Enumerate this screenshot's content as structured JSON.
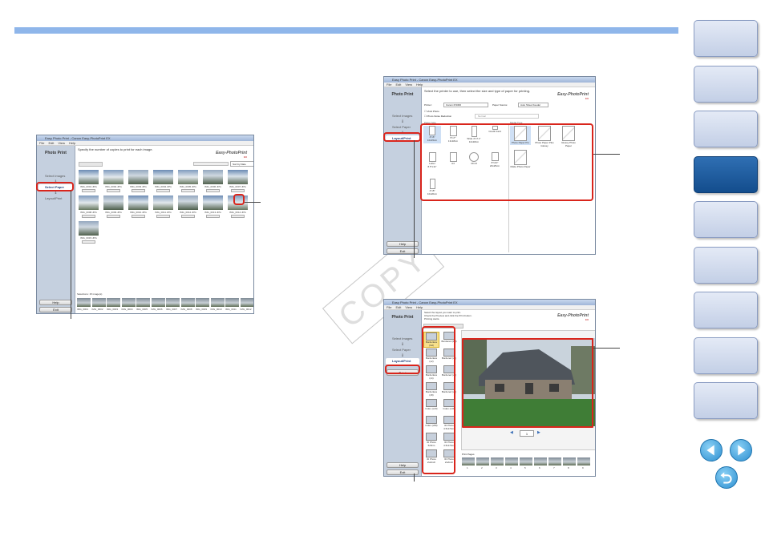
{
  "nav": {
    "tab_count": 9,
    "active_index": 3,
    "prev_icon": "left-arrow-icon",
    "next_icon": "right-arrow-icon",
    "return_icon": "return-arrow-icon"
  },
  "watermark": "COPY",
  "window1": {
    "title": "Easy Photo Print - Canon Easy-PhotoPrint EX",
    "menu": [
      "File",
      "Edit",
      "View",
      "Help"
    ],
    "sidebar_title": "Photo Print",
    "steps": [
      "Select Images",
      "Select Paper",
      "Layout/Print"
    ],
    "buttons": [
      "Help",
      "Exit"
    ],
    "instruction": "Specify the number of copies to print for each image.",
    "brand": "Easy-PhotoPrint",
    "brand_sub": "EX",
    "zoom_label": "Sort by Date",
    "thumbs": [
      "IMG_0001.JPG",
      "IMG_0002.JPG",
      "IMG_0003.JPG",
      "IMG_0004.JPG",
      "IMG_0005.JPG",
      "IMG_0006.JPG",
      "IMG_0007.JPG",
      "IMG_0008.JPG",
      "IMG_0009.JPG",
      "IMG_0010.JPG",
      "IMG_0011.JPG",
      "IMG_0012.JPG",
      "IMG_0013.JPG",
      "IMG_0014.JPG",
      "IMG_0015.JPG"
    ],
    "selection_label": "Selections: 15 image(s)",
    "strip": [
      "IMG_0001",
      "IMG_0002",
      "IMG_0003",
      "IMG_0004",
      "IMG_0005",
      "IMG_0006",
      "IMG_0007",
      "IMG_0008",
      "IMG_0009",
      "IMG_0010",
      "IMG_0011",
      "IMG_0012"
    ]
  },
  "window2": {
    "title": "Easy Photo Print - Canon Easy-PhotoPrint EX",
    "menu": [
      "File",
      "Edit",
      "View",
      "Help"
    ],
    "sidebar_title": "Photo Print",
    "steps": [
      "Select Images",
      "Select Paper",
      "Layout/Print"
    ],
    "buttons": [
      "Help",
      "Exit"
    ],
    "instruction": "Select the printer to use, then select the size and type of paper for printing.",
    "brand": "Easy-PhotoPrint",
    "brand_sub": "EX",
    "printer_label": "Printer:",
    "printer_value": "Canon iP4300",
    "source_label": "Paper Source:",
    "source_value": "Auto Sheet Feeder",
    "option1": "Vivid Photo",
    "option2": "Photo Noise Reduction",
    "option2_value": "Normal",
    "paper_size_header": "Paper Size",
    "media_type_header": "Media Type",
    "sizes": [
      {
        "name": "4\"x6\"",
        "sub": "10x15cm"
      },
      {
        "name": "5\"x7\"",
        "sub": "13x18cm"
      },
      {
        "name": "Wide 4\"x7.1\"",
        "sub": "10x18cm"
      },
      {
        "name": "Credit Card",
        "sub": ""
      },
      {
        "name": "Letter",
        "sub": "8.5\"x11\""
      },
      {
        "name": "A4",
        "sub": ""
      },
      {
        "name": "CD-R",
        "sub": ""
      },
      {
        "name": "8\"x10\"",
        "sub": "20x25cm"
      },
      {
        "name": "4\"x8\"",
        "sub": "10x20cm"
      }
    ],
    "types": [
      "Photo Paper Pro",
      "Photo Paper Plus Glossy",
      "Glossy Photo Paper",
      "Matte Photo Paper"
    ]
  },
  "window3": {
    "title": "Easy Photo Print - Canon Easy-PhotoPrint EX",
    "menu": [
      "File",
      "Edit",
      "View",
      "Help"
    ],
    "sidebar_title": "Photo Print",
    "steps": [
      "Select Images",
      "Select Paper",
      "Layout/Print"
    ],
    "print_button": "Print",
    "buttons": [
      "Help",
      "Exit"
    ],
    "instruction_lines": [
      "Select the layout you want to print.",
      "Check the Preview and click the Print button.",
      "Printing starts."
    ],
    "brand": "Easy-PhotoPrint",
    "brand_sub": "EX",
    "layouts": [
      "Borderless (full)",
      "Bordered (full)",
      "Borderless (x2)",
      "Bordered (x2)",
      "Borderless (x4)",
      "Bordered (x4)",
      "Borderless (x8)",
      "Bordered (x8)",
      "Index (x20)",
      "Index (x40)",
      "Index (x80)",
      "ID Photo 4.5x3.5cm",
      "ID Photo 5x5cm",
      "ID Photo 4.5x3.5cm",
      "ID Photo 2x2inch",
      "ID Photo 2x2inch"
    ],
    "page_value": "1",
    "strip_label": "Print Pages",
    "strip_numbers": [
      "1",
      "2",
      "3",
      "4",
      "5",
      "6",
      "7",
      "8",
      "9"
    ]
  }
}
